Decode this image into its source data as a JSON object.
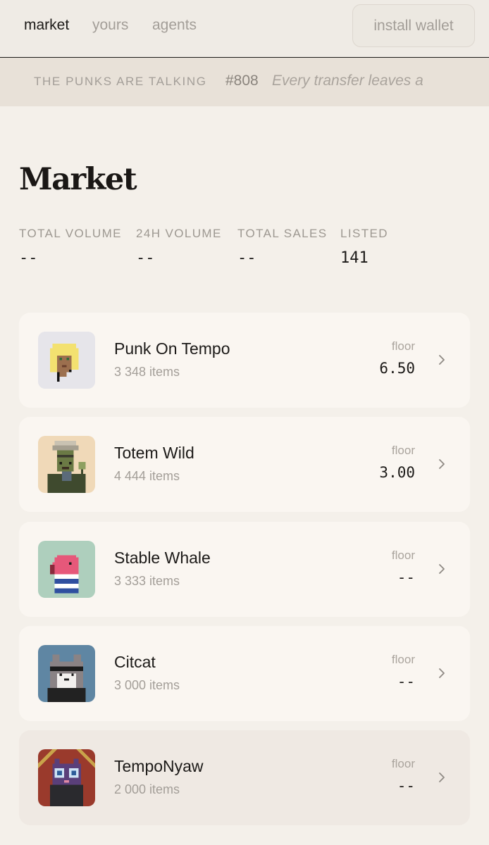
{
  "nav": {
    "market": "market",
    "yours": "yours",
    "agents": "agents",
    "install_wallet": "install wallet"
  },
  "ticker": {
    "label": "THE PUNKS ARE TALKING",
    "id": "#808",
    "text": "Every transfer leaves a"
  },
  "page": {
    "title": "Market"
  },
  "stats": [
    {
      "label": "TOTAL VOLUME",
      "value": "--"
    },
    {
      "label": "24H VOLUME",
      "value": "--"
    },
    {
      "label": "TOTAL SALES",
      "value": "--"
    },
    {
      "label": "LISTED",
      "value": "141"
    }
  ],
  "collections": [
    {
      "name": "Punk On Tempo",
      "count": "3 348 items",
      "floor_label": "floor",
      "floor": "6.50",
      "icon": "punk-avatar"
    },
    {
      "name": "Totem Wild",
      "count": "4 444 items",
      "floor_label": "floor",
      "floor": "3.00",
      "icon": "totem-avatar"
    },
    {
      "name": "Stable Whale",
      "count": "3 333 items",
      "floor_label": "floor",
      "floor": "--",
      "icon": "whale-avatar"
    },
    {
      "name": "Citcat",
      "count": "3 000 items",
      "floor_label": "floor",
      "floor": "--",
      "icon": "cat-avatar"
    },
    {
      "name": "TempoNyaw",
      "count": "2 000 items",
      "floor_label": "floor",
      "floor": "--",
      "icon": "nyaw-avatar"
    }
  ],
  "colors": {
    "background": "#f4f0ea",
    "card": "#faf6f1",
    "muted_text": "#a39e98",
    "text": "#1c1a18"
  }
}
